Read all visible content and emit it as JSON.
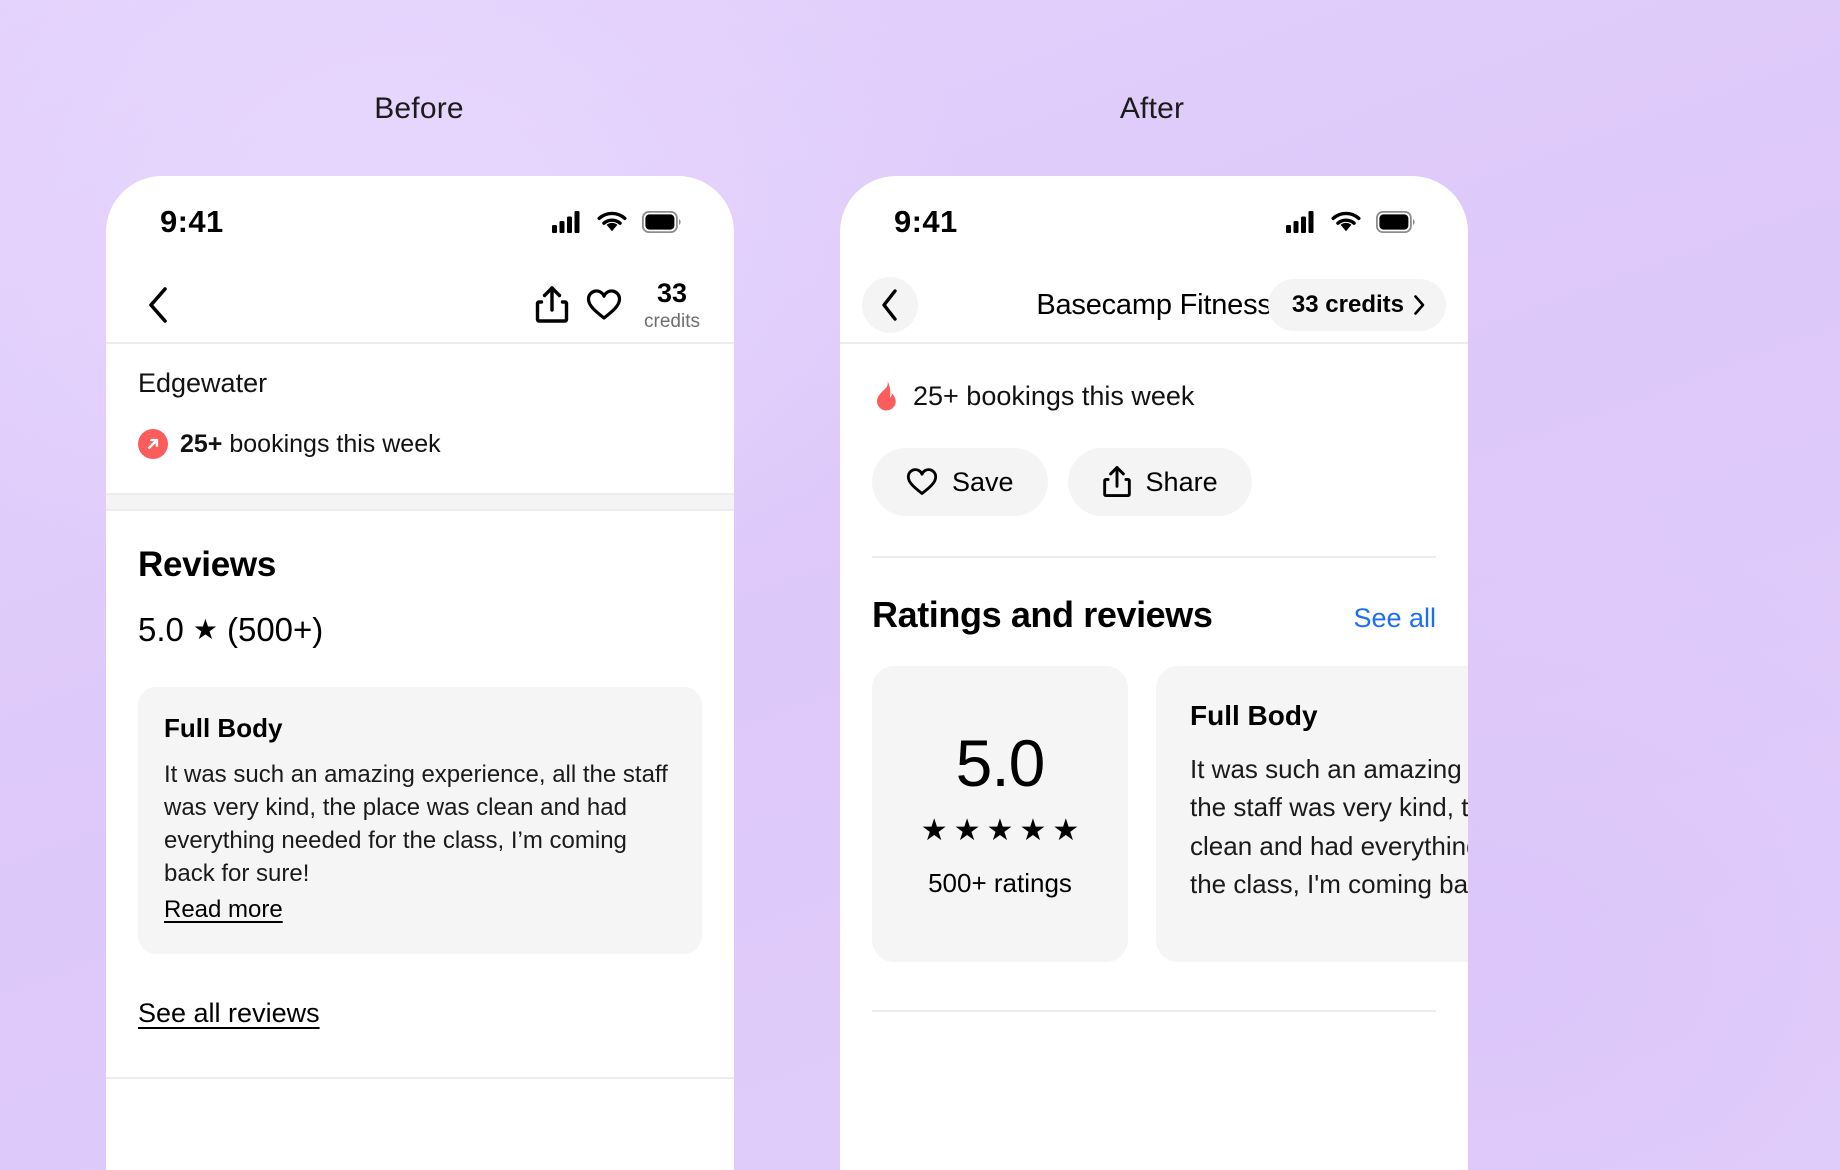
{
  "labels": {
    "before": "Before",
    "after": "After"
  },
  "colors": {
    "background": "#e0ccfb",
    "accent_red": "#fb5c5c",
    "link_blue": "#1c6ef2",
    "card_gray": "#f5f5f5"
  },
  "before": {
    "status": {
      "time": "9:41",
      "cellular_icon": "cellular-signal-icon",
      "wifi_icon": "wifi-icon",
      "battery_icon": "battery-icon"
    },
    "nav": {
      "back_icon": "chevron-left-icon",
      "share_icon": "share-icon",
      "favorite_icon": "heart-icon",
      "credits_value": "33",
      "credits_label": "credits"
    },
    "neighborhood": "Edgewater",
    "bookings": {
      "badge_icon": "trending-up-arrow-icon",
      "count": "25+",
      "text": "bookings this week"
    },
    "reviews": {
      "section_title": "Reviews",
      "score": "5.0",
      "star_icon": "star-filled-icon",
      "count": "(500+)",
      "card": {
        "title": "Full Body",
        "body": "It was such an amazing experience, all the staff was very kind, the place was clean and had everything needed for the class, I’m coming back for sure!",
        "read_more": "Read more"
      },
      "see_all": "See all reviews"
    }
  },
  "after": {
    "status": {
      "time": "9:41",
      "cellular_icon": "cellular-signal-icon",
      "wifi_icon": "wifi-icon",
      "battery_icon": "battery-icon"
    },
    "nav": {
      "back_icon": "chevron-left-icon",
      "title": "Basecamp Fitness",
      "credits_text": "33 credits",
      "credits_chevron": "chevron-right-icon"
    },
    "bookings": {
      "badge_icon": "flame-icon",
      "text": "25+ bookings this week"
    },
    "actions": [
      {
        "label": "Save",
        "icon": "heart-icon"
      },
      {
        "label": "Share",
        "icon": "share-icon"
      }
    ],
    "reviews": {
      "section_title": "Ratings and reviews",
      "see_all": "See all",
      "score_card": {
        "score": "5.0",
        "stars": 5,
        "star_icon": "star-filled-icon",
        "ratings_label": "500+ ratings"
      },
      "review_card": {
        "title": "Full Body",
        "body": "It was such an amazing expe\nthe staff was very kind, the p\nclean and had everything ne\nthe class, I'm coming back fo"
      }
    }
  }
}
